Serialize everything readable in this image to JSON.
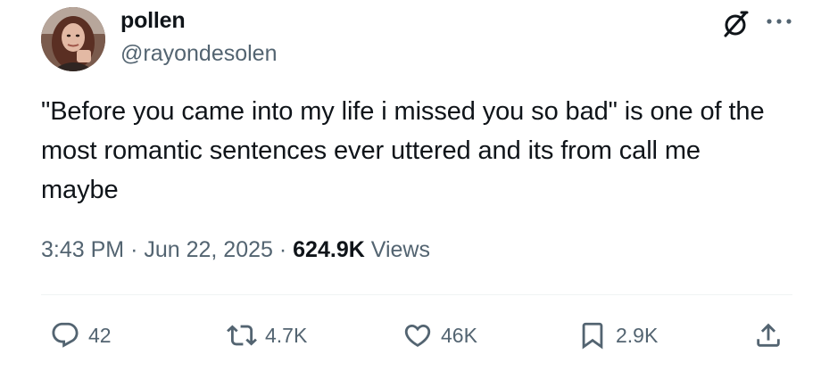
{
  "author": {
    "name": "pollen",
    "handle": "@rayondesolen"
  },
  "icons": {
    "grok": "grok-icon",
    "more": "more-icon",
    "reply": "reply-icon",
    "repost": "repost-icon",
    "like": "heart-icon",
    "bookmark": "bookmark-icon",
    "share": "share-icon"
  },
  "tweet": {
    "text": "\"Before you came into my life i missed you so bad\" is one of the most romantic sentences ever uttered and its from call me maybe",
    "time": "3:43 PM",
    "date": "Jun 22, 2025",
    "separator": "·",
    "views_count": "624.9K",
    "views_label": "Views"
  },
  "actions": {
    "replies": "42",
    "reposts": "4.7K",
    "likes": "46K",
    "bookmarks": "2.9K"
  },
  "colors": {
    "text": "#0f1419",
    "secondary": "#536471",
    "divider": "#eff3f4"
  }
}
